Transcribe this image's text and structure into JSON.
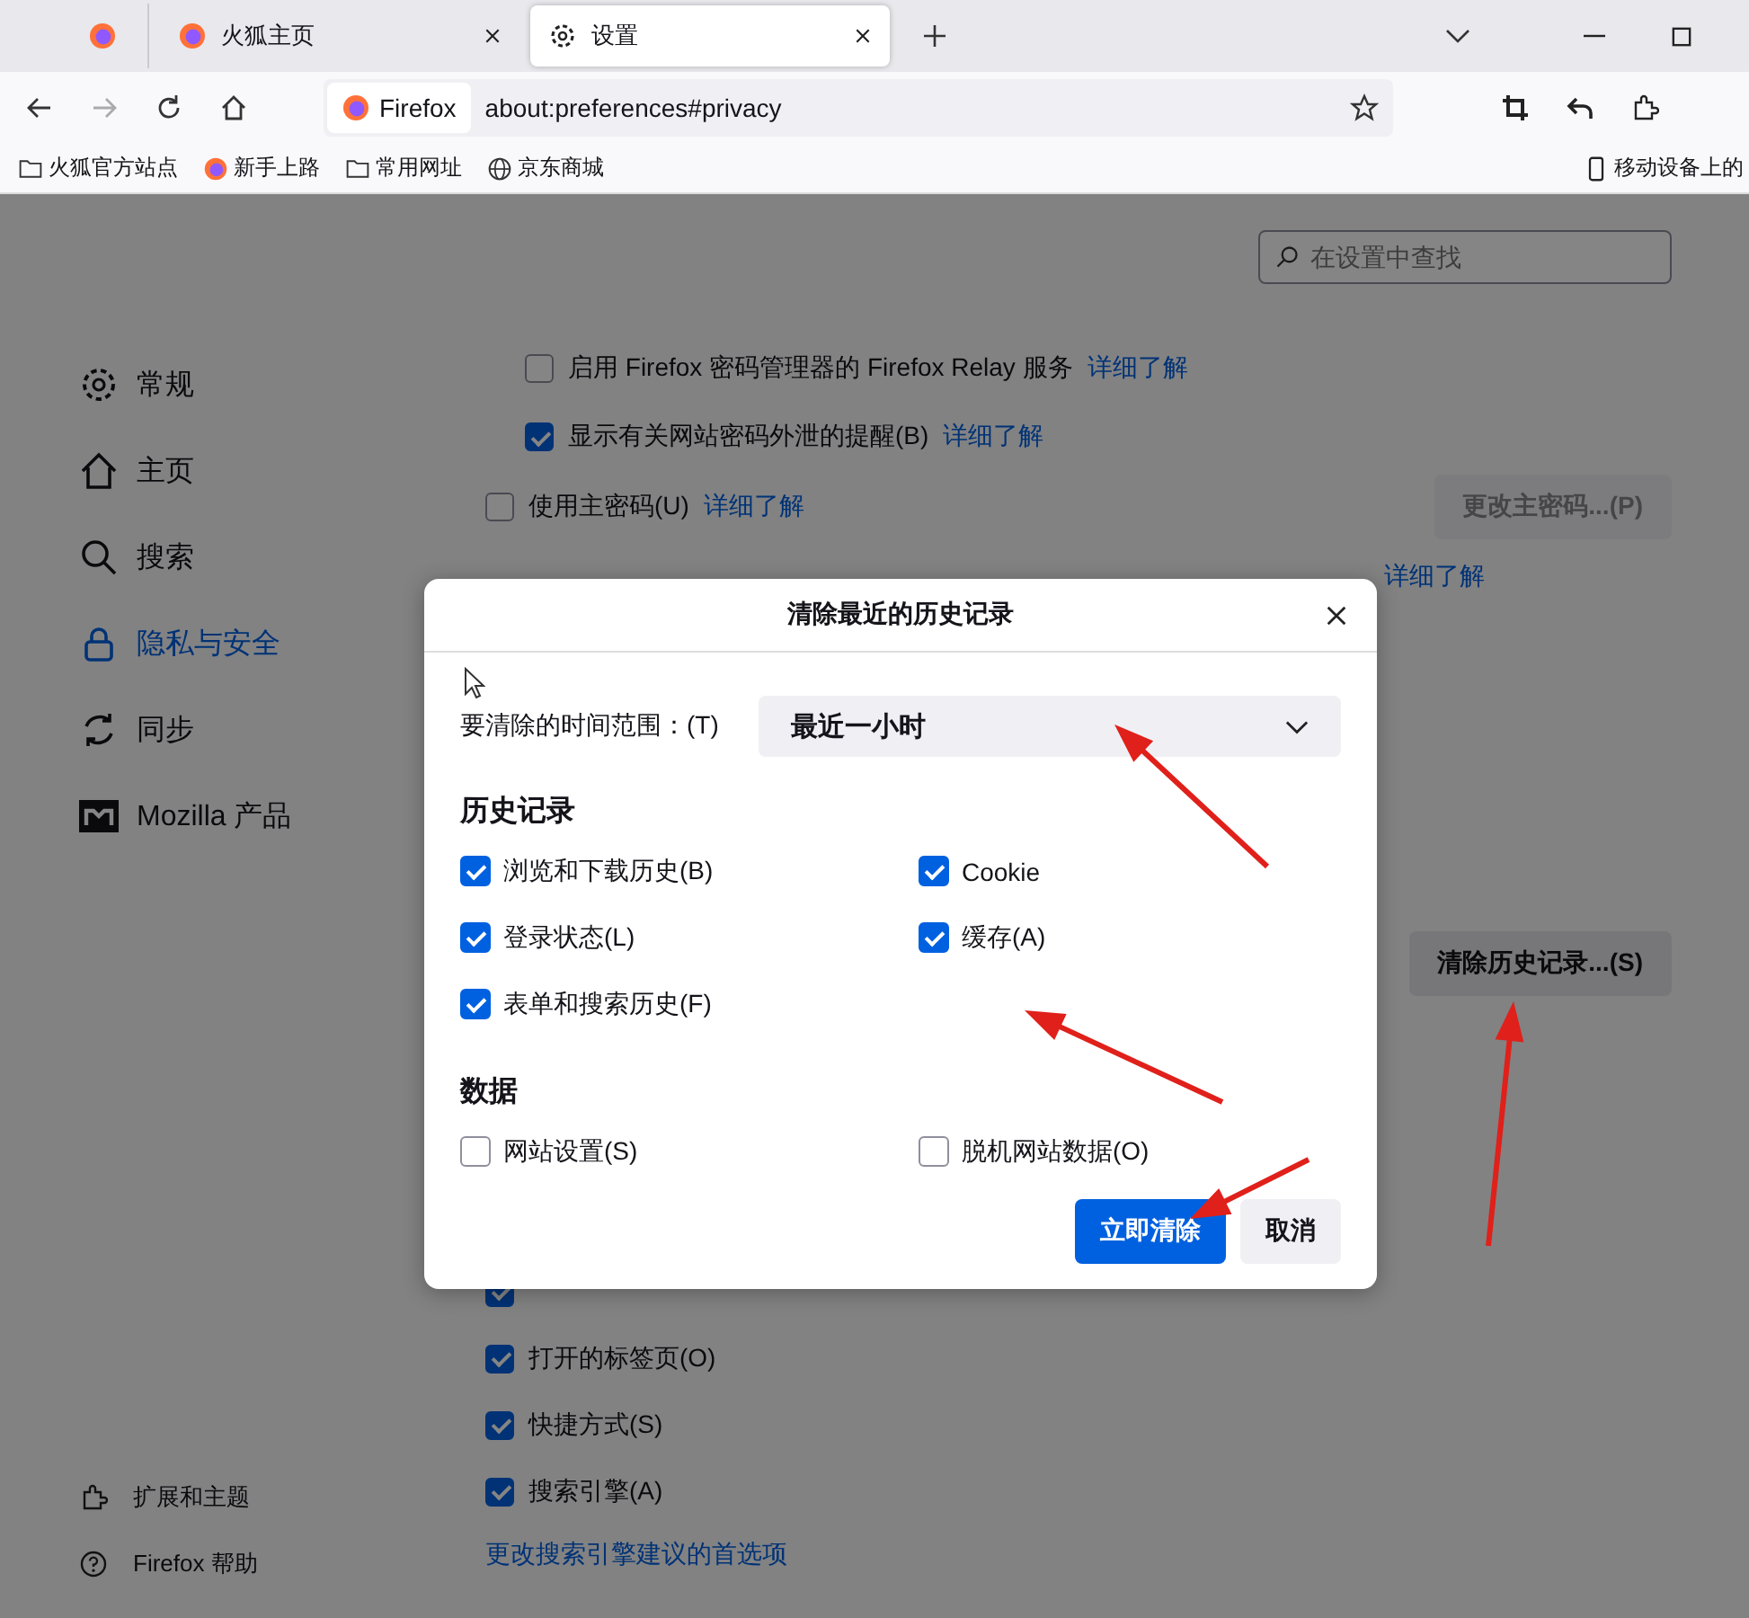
{
  "tabs": [
    {
      "title": "火狐主页",
      "selected": false
    },
    {
      "title": "设置",
      "selected": true
    }
  ],
  "address": {
    "identity": "Firefox",
    "url": "about:preferences#privacy"
  },
  "bookmarks": [
    {
      "label": "火狐官方站点",
      "kind": "folder"
    },
    {
      "label": "新手上路",
      "kind": "firefox"
    },
    {
      "label": "常用网址",
      "kind": "folder"
    },
    {
      "label": "京东商城",
      "kind": "globe"
    }
  ],
  "mobile_bookmarks": "移动设备上的",
  "search": {
    "placeholder": "在设置中查找"
  },
  "sidebar": {
    "items": [
      {
        "label": "常规",
        "selected": false
      },
      {
        "label": "主页",
        "selected": false
      },
      {
        "label": "搜索",
        "selected": false
      },
      {
        "label": "隐私与安全",
        "selected": true
      },
      {
        "label": "同步",
        "selected": false
      },
      {
        "label": "Mozilla 产品",
        "selected": false
      }
    ],
    "footer": [
      {
        "label": "扩展和主题"
      },
      {
        "label": "Firefox 帮助"
      }
    ]
  },
  "settings_top": [
    {
      "kind": "nested",
      "label": "启用 Firefox 密码管理器的 Firefox Relay 服务",
      "link": "详细了解",
      "checked": false
    },
    {
      "kind": "nested",
      "label": "显示有关网站密码外泄的提醒(B)",
      "link": "详细了解",
      "checked": true
    },
    {
      "kind": "top",
      "label": "使用主密码(U)",
      "link": "详细了解",
      "checked": false,
      "button": "更改主密码...(P)"
    },
    {
      "kind": "covered",
      "link": "详细了解"
    }
  ],
  "clear_history_button": "清除历史记录...(S)",
  "settings_bottom": [
    {
      "checked": true
    },
    {
      "label": "打开的标签页(O)",
      "checked": true
    },
    {
      "label": "快捷方式(S)",
      "checked": true
    },
    {
      "label": "搜索引擎(A)",
      "checked": true
    }
  ],
  "search_suggestions_link": "更改搜索引擎建议的首选项",
  "dialog": {
    "title": "清除最近的历史记录",
    "range_label": "要清除的时间范围：(T)",
    "range_value": "最近一小时",
    "sections": [
      {
        "heading": "历史记录",
        "options": [
          {
            "label": "浏览和下载历史(B)",
            "checked": true
          },
          {
            "label": "Cookie",
            "checked": true
          },
          {
            "label": "登录状态(L)",
            "checked": true
          },
          {
            "label": "缓存(A)",
            "checked": true
          },
          {
            "label": "表单和搜索历史(F)",
            "checked": true
          }
        ]
      },
      {
        "heading": "数据",
        "options": [
          {
            "label": "网站设置(S)",
            "checked": false
          },
          {
            "label": "脱机网站数据(O)",
            "checked": false
          }
        ]
      }
    ],
    "buttons": [
      {
        "label": "立即清除",
        "kind": "primary"
      },
      {
        "label": "取消",
        "kind": "secondary"
      }
    ]
  }
}
